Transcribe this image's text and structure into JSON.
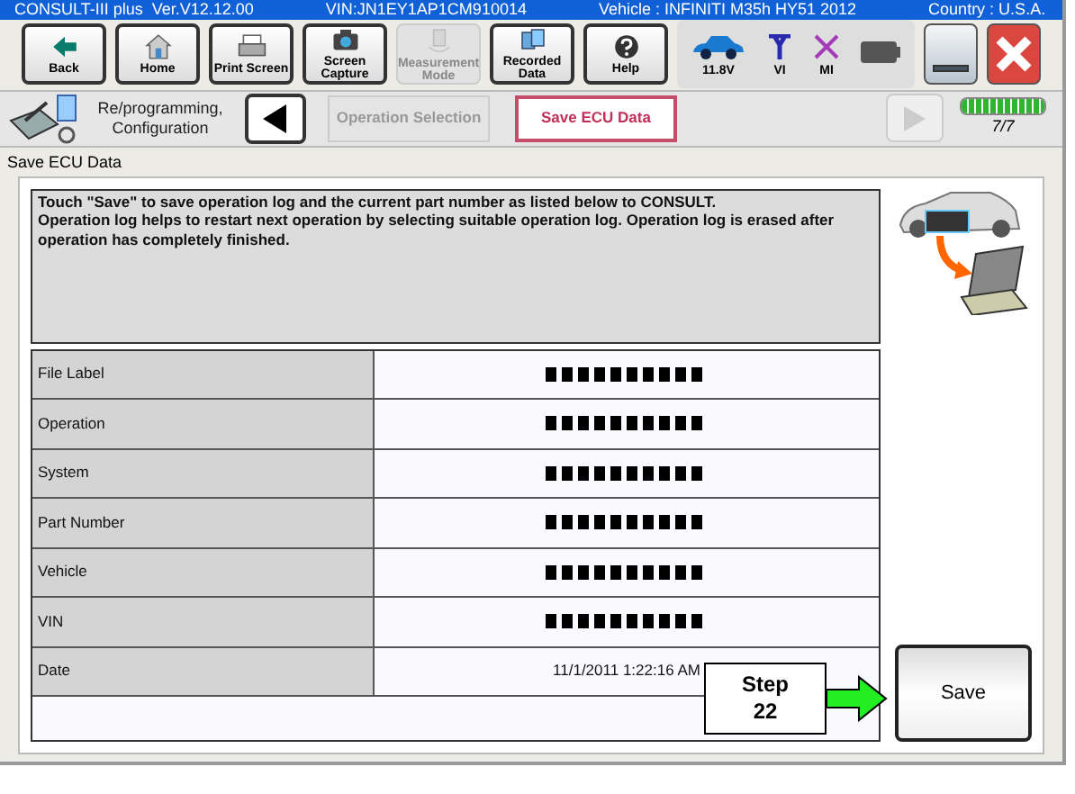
{
  "title_bar": [
    "CONSULT-III plus  Ver.V12.12.00",
    "VIN:JN1EY1AP1CM910014",
    "Vehicle : INFINITI M35h HY51 2012",
    "Country : U.S.A."
  ],
  "toolbar": [
    {
      "kind": "back",
      "label": "Back",
      "disabled": false
    },
    {
      "kind": "home",
      "label": "Home",
      "disabled": false
    },
    {
      "kind": "print",
      "label": "Print Screen",
      "disabled": false
    },
    {
      "kind": "camera",
      "label": "Screen Capture",
      "disabled": false
    },
    {
      "kind": "measure",
      "label": "Measurement Mode",
      "disabled": true
    },
    {
      "kind": "recorded",
      "label": "Recorded Data",
      "disabled": false
    },
    {
      "kind": "help",
      "label": "Help",
      "disabled": false
    }
  ],
  "status": [
    {
      "kind": "car",
      "label": "11.8V"
    },
    {
      "kind": "vi",
      "label": "VI"
    },
    {
      "kind": "mi",
      "label": "MI"
    },
    {
      "kind": "battery"
    }
  ],
  "nav": {
    "mode": "Re/programming, Configuration",
    "steps": [
      {
        "label": "Operation Selection",
        "selected": false
      },
      {
        "label": "Save ECU Data",
        "selected": true
      }
    ],
    "progress": {
      "label": "7/7",
      "level": 1
    }
  },
  "section_title": "Save ECU Data",
  "message": "Touch \"Save\" to save operation log and the current part number as listed below to CONSULT.\nOperation log helps to restart next operation by selecting suitable operation log. Operation log is erased after operation has completely finished.",
  "rows": [
    {
      "label": "File Label",
      "redacted": true
    },
    {
      "label": "Operation",
      "redacted": true
    },
    {
      "label": "System",
      "redacted": true
    },
    {
      "label": "Part Number",
      "redacted": true
    },
    {
      "label": "Vehicle",
      "redacted": true
    },
    {
      "label": "VIN",
      "redacted": true
    },
    {
      "label": "Date",
      "value": "11/1/2011 1:22:16 AM",
      "redacted": false
    }
  ],
  "callout": "Step 22",
  "save_button": "Save"
}
